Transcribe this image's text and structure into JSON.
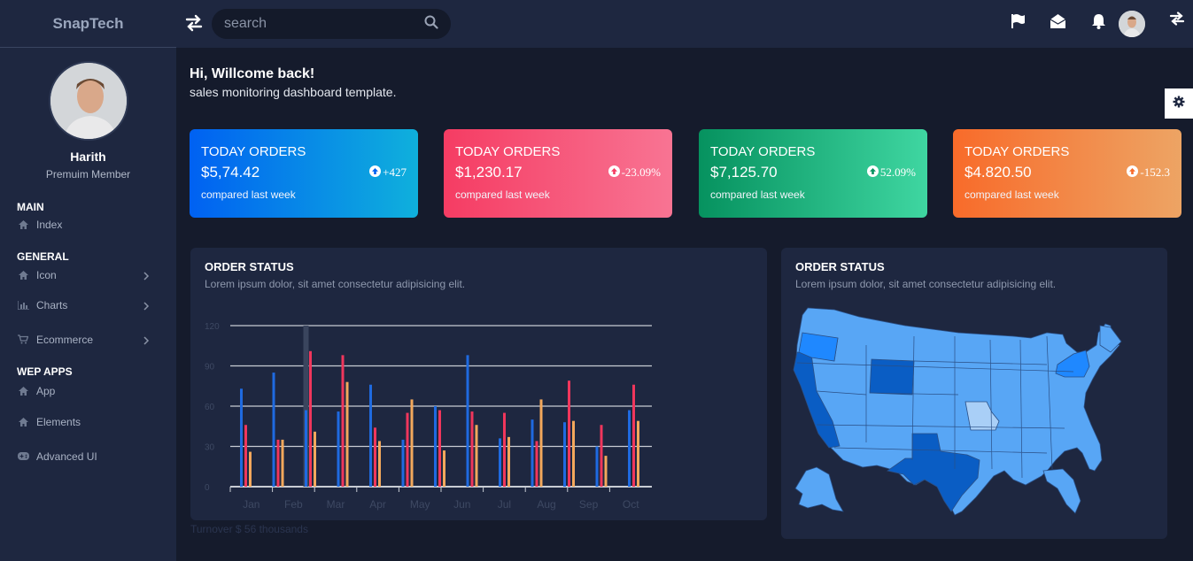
{
  "brand": "SnapTech",
  "search": {
    "placeholder": "search"
  },
  "profile": {
    "name": "Harith",
    "role": "Premuim Member"
  },
  "sidebar": {
    "sections": [
      {
        "title": "MAIN",
        "items": [
          {
            "label": "Index",
            "icon": "home-icon",
            "chevron": false
          }
        ]
      },
      {
        "title": "GENERAL",
        "items": [
          {
            "label": "Icon",
            "icon": "home-icon",
            "chevron": true
          },
          {
            "label": "Charts",
            "icon": "bar-chart-icon",
            "chevron": true
          },
          {
            "label": "Ecommerce",
            "icon": "cart-icon",
            "chevron": true
          }
        ]
      },
      {
        "title": "WEP APPS",
        "items": [
          {
            "label": "App",
            "icon": "home-icon",
            "chevron": false
          },
          {
            "label": "Elements",
            "icon": "home-icon",
            "chevron": false
          },
          {
            "label": "Advanced UI",
            "icon": "gamepad-icon",
            "chevron": false
          }
        ]
      }
    ]
  },
  "header": {
    "greeting": "Hi, Willcome back!",
    "subtitle": "sales monitoring dashboard template."
  },
  "cards": [
    {
      "title": "TODAY ORDERS",
      "value": "$5,74.42",
      "change": "+427",
      "footer": "compared last week",
      "from": "#0061f2",
      "to": "#0fb0dc"
    },
    {
      "title": "TODAY ORDERS",
      "value": "$1,230.17",
      "change": "-23.09%",
      "footer": "compared last week",
      "from": "#f53c63",
      "to": "#f87493"
    },
    {
      "title": "TODAY ORDERS",
      "value": "$7,125.70",
      "change": "52.09%",
      "footer": "compared last week",
      "from": "#06925f",
      "to": "#3fd6a1"
    },
    {
      "title": "TODAY ORDERS",
      "value": "$4.820.50",
      "change": "-152.3",
      "footer": "compared last week",
      "from": "#f86b2a",
      "to": "#eda464"
    }
  ],
  "order_panel": {
    "title": "ORDER STATUS",
    "subtitle": "Lorem ipsum dolor, sit amet consectetur adipisicing elit."
  },
  "map_panel": {
    "title": "ORDER STATUS",
    "subtitle": "Lorem ipsum dolor, sit amet consectetur adipisicing elit."
  },
  "footnote": "Turnover $ 56 thousands",
  "colors": {
    "series1": "#1f6ae0",
    "series2": "#f0365c",
    "series3": "#f3a85c",
    "highlight_bar": "#3a455e"
  },
  "chart_data": {
    "type": "bar",
    "categories": [
      "Jan",
      "Feb",
      "Mar",
      "Apr",
      "May",
      "Jun",
      "Jul",
      "Aug",
      "Sep",
      "Oct"
    ],
    "series": [
      {
        "values": [
          73,
          85,
          57,
          56,
          76,
          35,
          60,
          98,
          36,
          50,
          48,
          30,
          57
        ]
      },
      {
        "values": [
          46,
          35,
          101,
          98,
          44,
          55,
          57,
          56,
          55,
          34,
          79,
          46,
          76
        ]
      },
      {
        "values": [
          26,
          35,
          41,
          78,
          34,
          65,
          27,
          46,
          37,
          65,
          49,
          23,
          49
        ]
      }
    ],
    "yticks": [
      0,
      30,
      60,
      90,
      120
    ],
    "ylim": [
      0,
      120
    ],
    "grid": true,
    "highlight_index": 1
  },
  "map": {
    "type": "choropleth-us",
    "base_color": "#58a6f5",
    "highlight_color": "#0a5dc4",
    "accent_color": "#1f88ff",
    "light_color": "#a9cff7"
  }
}
